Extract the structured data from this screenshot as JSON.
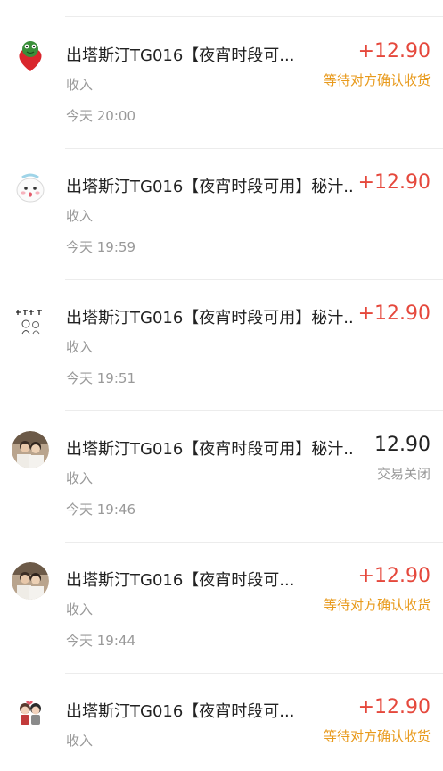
{
  "transactions": [
    {
      "title": "出塔斯汀TG016【夜宵时段可...",
      "type": "收入",
      "time": "今天 20:00",
      "amount": "+12.90",
      "status": "等待对方确认收货",
      "amount_style": "pos",
      "status_style": "pending",
      "avatar_icon": "frog-heart-avatar-icon"
    },
    {
      "title": "出塔斯汀TG016【夜宵时段可用】秘汁...",
      "type": "收入",
      "time": "今天 19:59",
      "amount": "+12.90",
      "status": "",
      "amount_style": "pos",
      "status_style": "",
      "avatar_icon": "cartoon-face-avatar-icon"
    },
    {
      "title": "出塔斯汀TG016【夜宵时段可用】秘汁...",
      "type": "收入",
      "time": "今天 19:51",
      "amount": "+12.90",
      "status": "",
      "amount_style": "pos",
      "status_style": "",
      "avatar_icon": "sketch-text-avatar-icon"
    },
    {
      "title": "出塔斯汀TG016【夜宵时段可用】秘汁...",
      "type": "收入",
      "time": "今天 19:46",
      "amount": "12.90",
      "status": "交易关闭",
      "amount_style": "neutral",
      "status_style": "closed",
      "avatar_icon": "photo-avatar-icon"
    },
    {
      "title": "出塔斯汀TG016【夜宵时段可...",
      "type": "收入",
      "time": "今天 19:44",
      "amount": "+12.90",
      "status": "等待对方确认收货",
      "amount_style": "pos",
      "status_style": "pending",
      "avatar_icon": "photo-avatar-icon"
    },
    {
      "title": "出塔斯汀TG016【夜宵时段可...",
      "type": "收入",
      "time": "",
      "amount": "+12.90",
      "status": "等待对方确认收货",
      "amount_style": "pos",
      "status_style": "pending",
      "avatar_icon": "couple-avatar-icon"
    }
  ]
}
